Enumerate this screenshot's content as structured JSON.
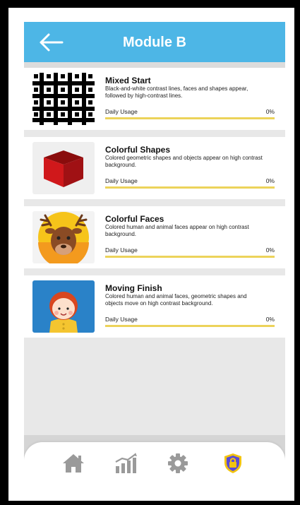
{
  "header": {
    "title": "Module B",
    "back_icon": "arrow-left-icon"
  },
  "modules": [
    {
      "title": "Mixed Start",
      "description": "Black-and-white contrast lines, faces and shapes appear, followed by high-contrast lines.",
      "usage_label": "Daily Usage",
      "usage_percent": "0%",
      "usage_value": 0,
      "thumbnail": "checkerboard-image"
    },
    {
      "title": "Colorful Shapes",
      "description": "Colored geometric shapes and objects appear on high contrast background.",
      "usage_label": "Daily Usage",
      "usage_percent": "0%",
      "usage_value": 0,
      "thumbnail": "red-cube-image"
    },
    {
      "title": "Colorful Faces",
      "description": "Colored human and animal faces appear on high contrast background.",
      "usage_label": "Daily Usage",
      "usage_percent": "0%",
      "usage_value": 0,
      "thumbnail": "moose-face-image"
    },
    {
      "title": "Moving Finish",
      "description": "Colored human and animal faces, geometric shapes and objects move on high contrast background.",
      "usage_label": "Daily Usage",
      "usage_percent": "0%",
      "usage_value": 0,
      "thumbnail": "child-face-image"
    }
  ],
  "bottom_nav": {
    "items": [
      {
        "icon": "home-icon"
      },
      {
        "icon": "bar-chart-icon"
      },
      {
        "icon": "gear-icon"
      },
      {
        "icon": "shield-lock-icon",
        "active": true
      }
    ]
  },
  "colors": {
    "header": "#4db6e6",
    "usage_bar": "#ecd35a",
    "nav_icon": "#9a9a9a",
    "active_icon": "#f2c40f"
  }
}
